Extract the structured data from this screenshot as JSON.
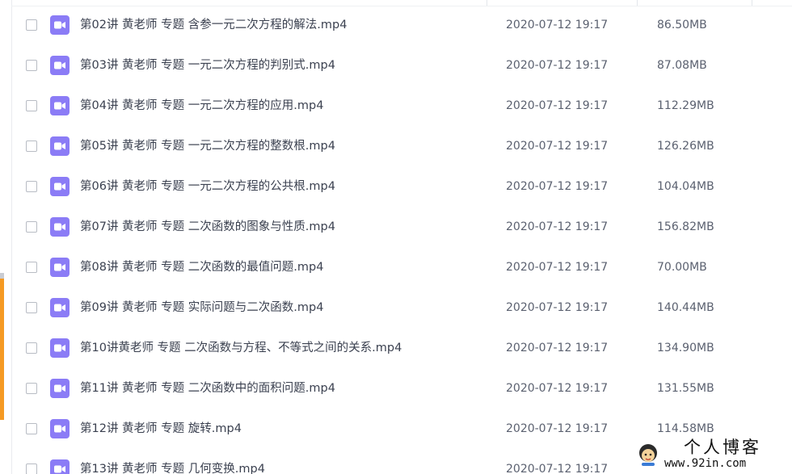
{
  "colors": {
    "video_icon": "#8b7cf6",
    "left_accent": "#f59a23",
    "text_primary": "#3b4150",
    "text_secondary": "#5b6170"
  },
  "file_icon_name": "video-file-icon",
  "files": [
    {
      "name": "第02讲 黄老师 专题 含参一元二次方程的解法.mp4",
      "date": "2020-07-12 19:17",
      "size": "86.50MB"
    },
    {
      "name": "第03讲 黄老师 专题 一元二次方程的判别式.mp4",
      "date": "2020-07-12 19:17",
      "size": "87.08MB"
    },
    {
      "name": "第04讲 黄老师 专题 一元二次方程的应用.mp4",
      "date": "2020-07-12 19:17",
      "size": "112.29MB"
    },
    {
      "name": "第05讲 黄老师 专题 一元二次方程的整数根.mp4",
      "date": "2020-07-12 19:17",
      "size": "126.26MB"
    },
    {
      "name": "第06讲 黄老师 专题 一元二次方程的公共根.mp4",
      "date": "2020-07-12 19:17",
      "size": "104.04MB"
    },
    {
      "name": "第07讲 黄老师 专题 二次函数的图象与性质.mp4",
      "date": "2020-07-12 19:17",
      "size": "156.82MB"
    },
    {
      "name": "第08讲 黄老师 专题 二次函数的最值问题.mp4",
      "date": "2020-07-12 19:17",
      "size": "70.00MB"
    },
    {
      "name": "第09讲 黄老师 专题 实际问题与二次函数.mp4",
      "date": "2020-07-12 19:17",
      "size": "140.44MB"
    },
    {
      "name": "第10讲黄老师 专题 二次函数与方程、不等式之间的关系.mp4",
      "date": "2020-07-12 19:17",
      "size": "134.90MB"
    },
    {
      "name": "第11讲 黄老师 专题 二次函数中的面积问题.mp4",
      "date": "2020-07-12 19:17",
      "size": "131.55MB"
    },
    {
      "name": "第12讲 黄老师 专题 旋转.mp4",
      "date": "2020-07-12 19:17",
      "size": "114.58MB"
    },
    {
      "name": "第13讲 黄老师 专题 几何变换.mp4",
      "date": "2020-07-12 19:17",
      "size": ""
    }
  ],
  "watermark": {
    "title": "个人博客",
    "url": "www.92in.com"
  }
}
